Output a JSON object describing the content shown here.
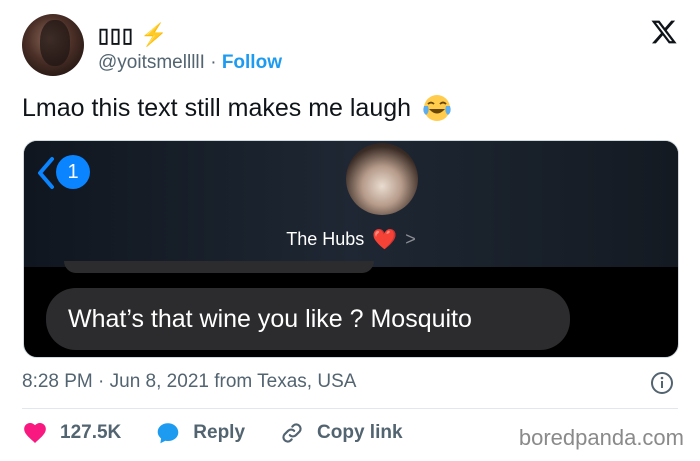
{
  "author": {
    "display_name": "▯▯▯",
    "bolt_emoji": "⚡",
    "handle": "@yoitsmellllI",
    "separator": "·",
    "follow_label": "Follow"
  },
  "tweet": {
    "text": "Lmao this text still makes me laugh"
  },
  "media": {
    "unread_count": "1",
    "contact_name": "The Hubs",
    "heart": "❤️",
    "chevron": ">",
    "message": "What’s that wine you like ? Mosquito"
  },
  "meta": {
    "time": "8:28 PM · Jun 8, 2021 from Texas, USA"
  },
  "actions": {
    "likes": "127.5K",
    "reply_label": "Reply",
    "copy_label": "Copy link"
  },
  "watermark": "boredpanda.com",
  "colors": {
    "link": "#1d9bf0",
    "like_heart": "#f91880",
    "ios_blue": "#0a84ff"
  }
}
